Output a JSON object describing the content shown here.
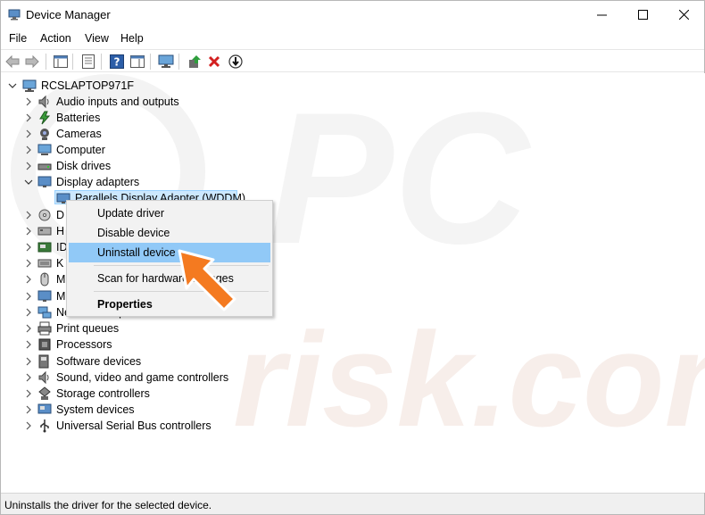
{
  "window": {
    "title": "Device Manager"
  },
  "menu": [
    "File",
    "Action",
    "View",
    "Help"
  ],
  "tree": {
    "root": "RCSLAPTOP971F",
    "categories": [
      {
        "label": "Audio inputs and outputs",
        "icon": "speaker-icon",
        "expanded": false
      },
      {
        "label": "Batteries",
        "icon": "battery-icon",
        "expanded": false
      },
      {
        "label": "Cameras",
        "icon": "camera-icon",
        "expanded": false
      },
      {
        "label": "Computer",
        "icon": "computer-icon",
        "expanded": false
      },
      {
        "label": "Disk drives",
        "icon": "disk-drive-icon",
        "expanded": false
      },
      {
        "label": "Display adapters",
        "icon": "monitor-icon",
        "expanded": true
      },
      {
        "label": "D",
        "icon": "dvd-drive-icon",
        "expanded": false
      },
      {
        "label": "H",
        "icon": "hid-icon",
        "expanded": false
      },
      {
        "label": "ID",
        "icon": "ide-controller-icon",
        "expanded": false
      },
      {
        "label": "K",
        "icon": "keyboard-icon",
        "expanded": false
      },
      {
        "label": "M",
        "icon": "mouse-icon",
        "expanded": false
      },
      {
        "label": "M",
        "icon": "monitor-icon",
        "expanded": false
      },
      {
        "label": "Network adapters",
        "icon": "network-icon",
        "expanded": false
      },
      {
        "label": "Print queues",
        "icon": "printer-icon",
        "expanded": false
      },
      {
        "label": "Processors",
        "icon": "processor-icon",
        "expanded": false
      },
      {
        "label": "Software devices",
        "icon": "software-device-icon",
        "expanded": false
      },
      {
        "label": "Sound, video and game controllers",
        "icon": "speaker-icon",
        "expanded": false
      },
      {
        "label": "Storage controllers",
        "icon": "storage-controller-icon",
        "expanded": false
      },
      {
        "label": "System devices",
        "icon": "system-device-icon",
        "expanded": false
      },
      {
        "label": "Universal Serial Bus controllers",
        "icon": "usb-icon",
        "expanded": false
      }
    ],
    "selected_device": "Parallels Display Adapter (WDDM)"
  },
  "context_menu": {
    "items": [
      "Update driver",
      "Disable device",
      "Uninstall device",
      "Scan for hardware changes",
      "Properties"
    ],
    "highlighted": "Uninstall device"
  },
  "status": {
    "text": "Uninstalls the driver for the selected device."
  },
  "colors": {
    "highlight": "#91c9f7",
    "selection": "#cce8ff",
    "arrow": "#f47a20",
    "watermark": "#f5f5f5"
  }
}
